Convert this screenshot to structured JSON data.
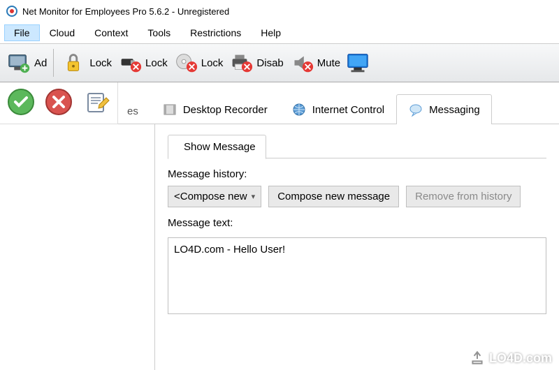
{
  "window": {
    "title": "Net Monitor for Employees Pro 5.6.2 - Unregistered"
  },
  "menu": {
    "file": "File",
    "cloud": "Cloud",
    "context": "Context",
    "tools": "Tools",
    "restrictions": "Restrictions",
    "help": "Help"
  },
  "toolbar": {
    "add": "Ad",
    "lock1": "Lock",
    "lock2": "Lock",
    "lock3": "Lock",
    "disable": "Disab",
    "mute": "Mute"
  },
  "tabs": {
    "partial": "es",
    "recorder": "Desktop Recorder",
    "internet": "Internet Control",
    "messaging": "Messaging"
  },
  "messaging": {
    "subtab": "Show Message",
    "history_label": "Message history:",
    "compose_dropdown": "<Compose new",
    "compose_button": "Compose new message",
    "remove_button": "Remove from history",
    "text_label": "Message text:",
    "text_value": "LO4D.com - Hello User!"
  },
  "watermark": {
    "text": "LO4D.com"
  }
}
